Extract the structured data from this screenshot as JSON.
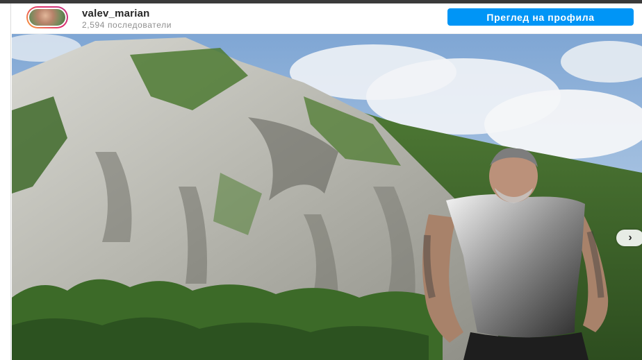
{
  "post_header": {
    "username": "valev_marian",
    "followers": "2,594 последователи",
    "view_profile_button": "Преглед на профила"
  },
  "carousel": {
    "next_icon": "chevron-right-icon",
    "next_glyph": "›"
  },
  "colors": {
    "accent_button": "#0095f6",
    "avatar_ring": [
      "#f9a13a",
      "#e1306c",
      "#c13584"
    ]
  }
}
